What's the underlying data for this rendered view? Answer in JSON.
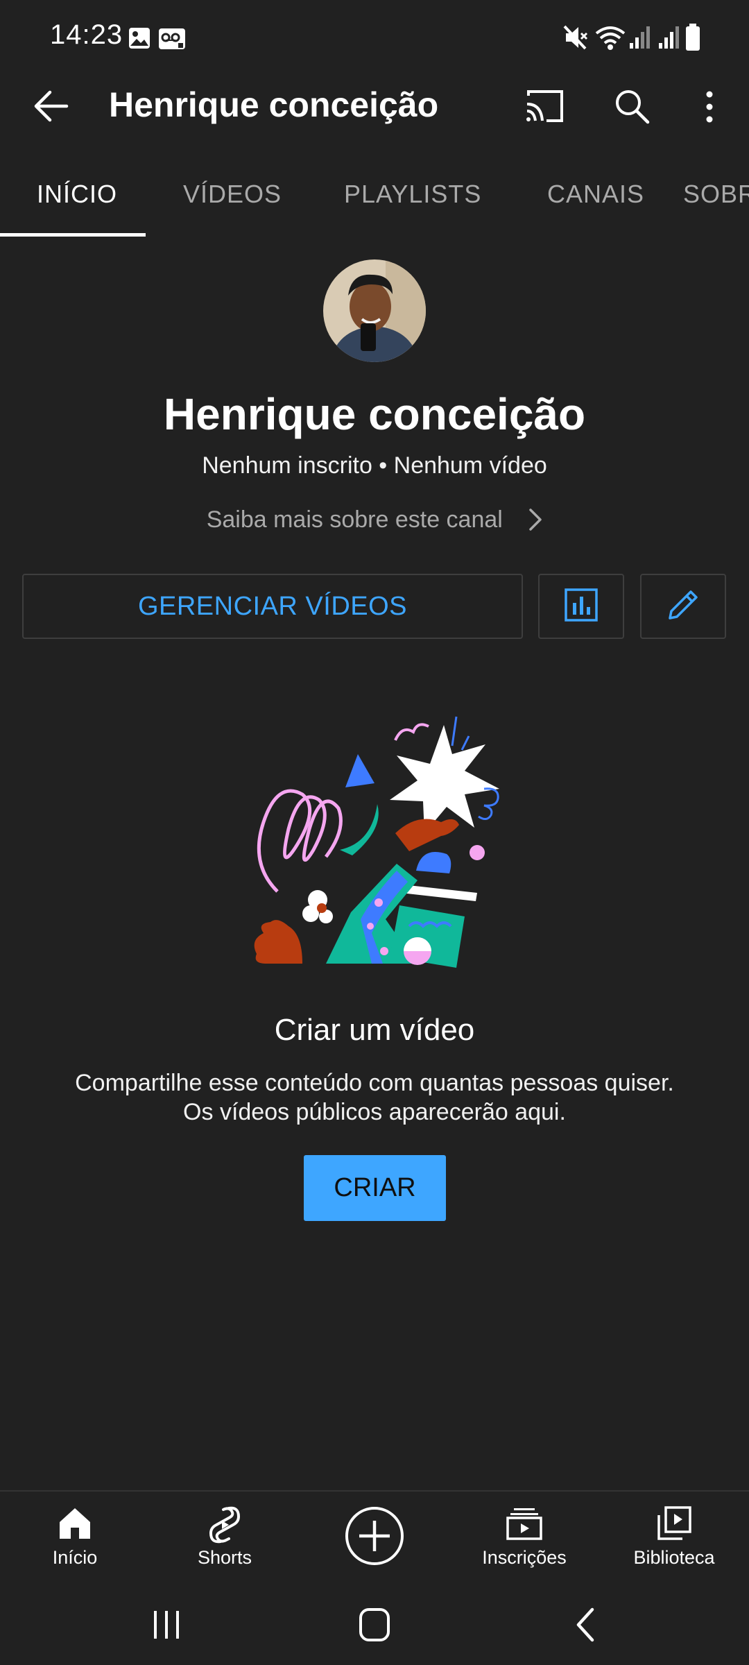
{
  "status_bar": {
    "time": "14:23",
    "left_icons": [
      "image-icon",
      "voicemail-icon"
    ],
    "right_icons": [
      "mute-icon",
      "wifi-icon",
      "signal-icon",
      "signal-icon",
      "battery-icon"
    ]
  },
  "app_bar": {
    "title": "Henrique conceição",
    "icons": [
      "back-arrow-icon",
      "cast-icon",
      "search-icon",
      "more-vert-icon"
    ]
  },
  "tabs": [
    {
      "label": "INÍCIO",
      "active": true
    },
    {
      "label": "VÍDEOS",
      "active": false
    },
    {
      "label": "PLAYLISTS",
      "active": false
    },
    {
      "label": "CANAIS",
      "active": false
    },
    {
      "label": "SOBRE",
      "active": false
    }
  ],
  "channel": {
    "name": "Henrique conceição",
    "stats": "Nenhum inscrito • Nenhum vídeo",
    "about_link": "Saiba mais sobre este canal"
  },
  "actions": {
    "manage_videos": "GERENCIAR VÍDEOS",
    "analytics_icon": "bar-chart-icon",
    "edit_icon": "pencil-icon"
  },
  "empty_state": {
    "title": "Criar um vídeo",
    "line1": "Compartilhe esse conteúdo com quantas pessoas quiser.",
    "line2": "Os vídeos públicos aparecerão aqui.",
    "button": "CRIAR"
  },
  "bottom_nav": [
    {
      "label": "Início",
      "icon": "home-icon"
    },
    {
      "label": "Shorts",
      "icon": "shorts-icon"
    },
    {
      "label": "",
      "icon": "create-plus-icon"
    },
    {
      "label": "Inscrições",
      "icon": "subscriptions-icon"
    },
    {
      "label": "Biblioteca",
      "icon": "library-icon"
    }
  ],
  "colors": {
    "background": "#212121",
    "accent": "#3ea6ff",
    "text": "#ffffff",
    "muted": "#aaaaaa"
  }
}
